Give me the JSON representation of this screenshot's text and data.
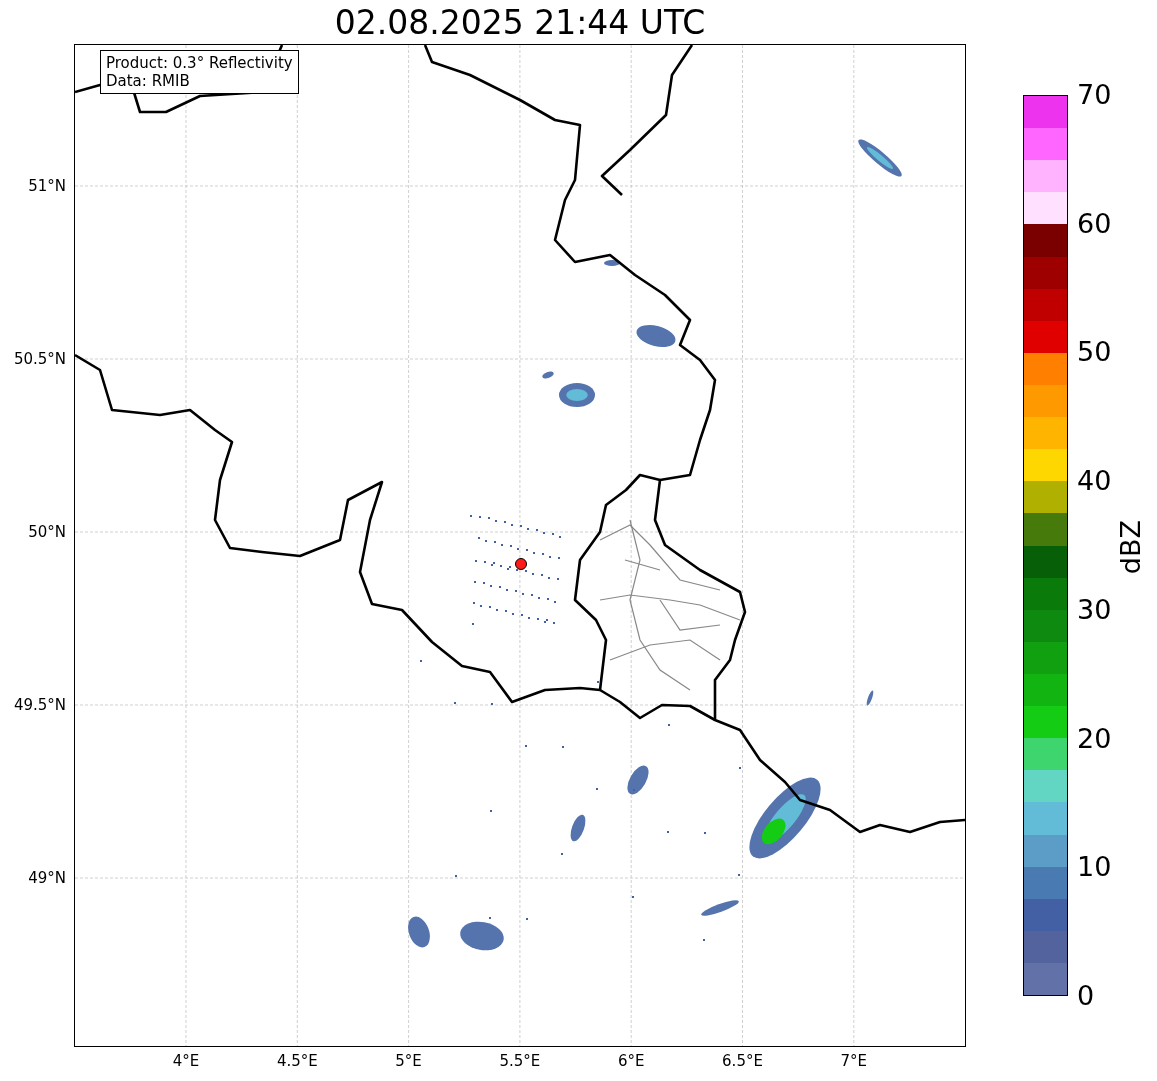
{
  "title": "02.08.2025 21:44 UTC",
  "info_box": {
    "lines": [
      "Product: 0.3° Reflectivity",
      "Data: RMIB"
    ]
  },
  "map": {
    "lat_labels": [
      "51°N",
      "50.5°N",
      "50°N",
      "49.5°N",
      "49°N"
    ],
    "lon_labels": [
      "4°E",
      "4.5°E",
      "5°E",
      "5.5°E",
      "6°E",
      "6.5°E",
      "7°E"
    ]
  },
  "colorbar": {
    "label": "dBZ",
    "ticks": [
      "70",
      "60",
      "50",
      "40",
      "30",
      "20",
      "10",
      "0"
    ],
    "segments": [
      {
        "color": "#ee33ee"
      },
      {
        "color": "#ff66ff"
      },
      {
        "color": "#ffb3ff"
      },
      {
        "color": "#ffe0ff"
      },
      {
        "color": "#7a0000"
      },
      {
        "color": "#9e0000"
      },
      {
        "color": "#c00000"
      },
      {
        "color": "#e00000"
      },
      {
        "color": "#ff7f00"
      },
      {
        "color": "#ff9900"
      },
      {
        "color": "#ffb400"
      },
      {
        "color": "#ffd700"
      },
      {
        "color": "#b0b000"
      },
      {
        "color": "#467a0a"
      },
      {
        "color": "#075f07"
      },
      {
        "color": "#0a7a0a"
      },
      {
        "color": "#0f8a10"
      },
      {
        "color": "#10a010"
      },
      {
        "color": "#12b412"
      },
      {
        "color": "#15cc15"
      },
      {
        "color": "#3ed46e"
      },
      {
        "color": "#62d6c2"
      },
      {
        "color": "#62bcd8"
      },
      {
        "color": "#5b9dc6"
      },
      {
        "color": "#4a7ab2"
      },
      {
        "color": "#4460a4"
      },
      {
        "color": "#52639e"
      },
      {
        "color": "#6272a8"
      }
    ]
  }
}
